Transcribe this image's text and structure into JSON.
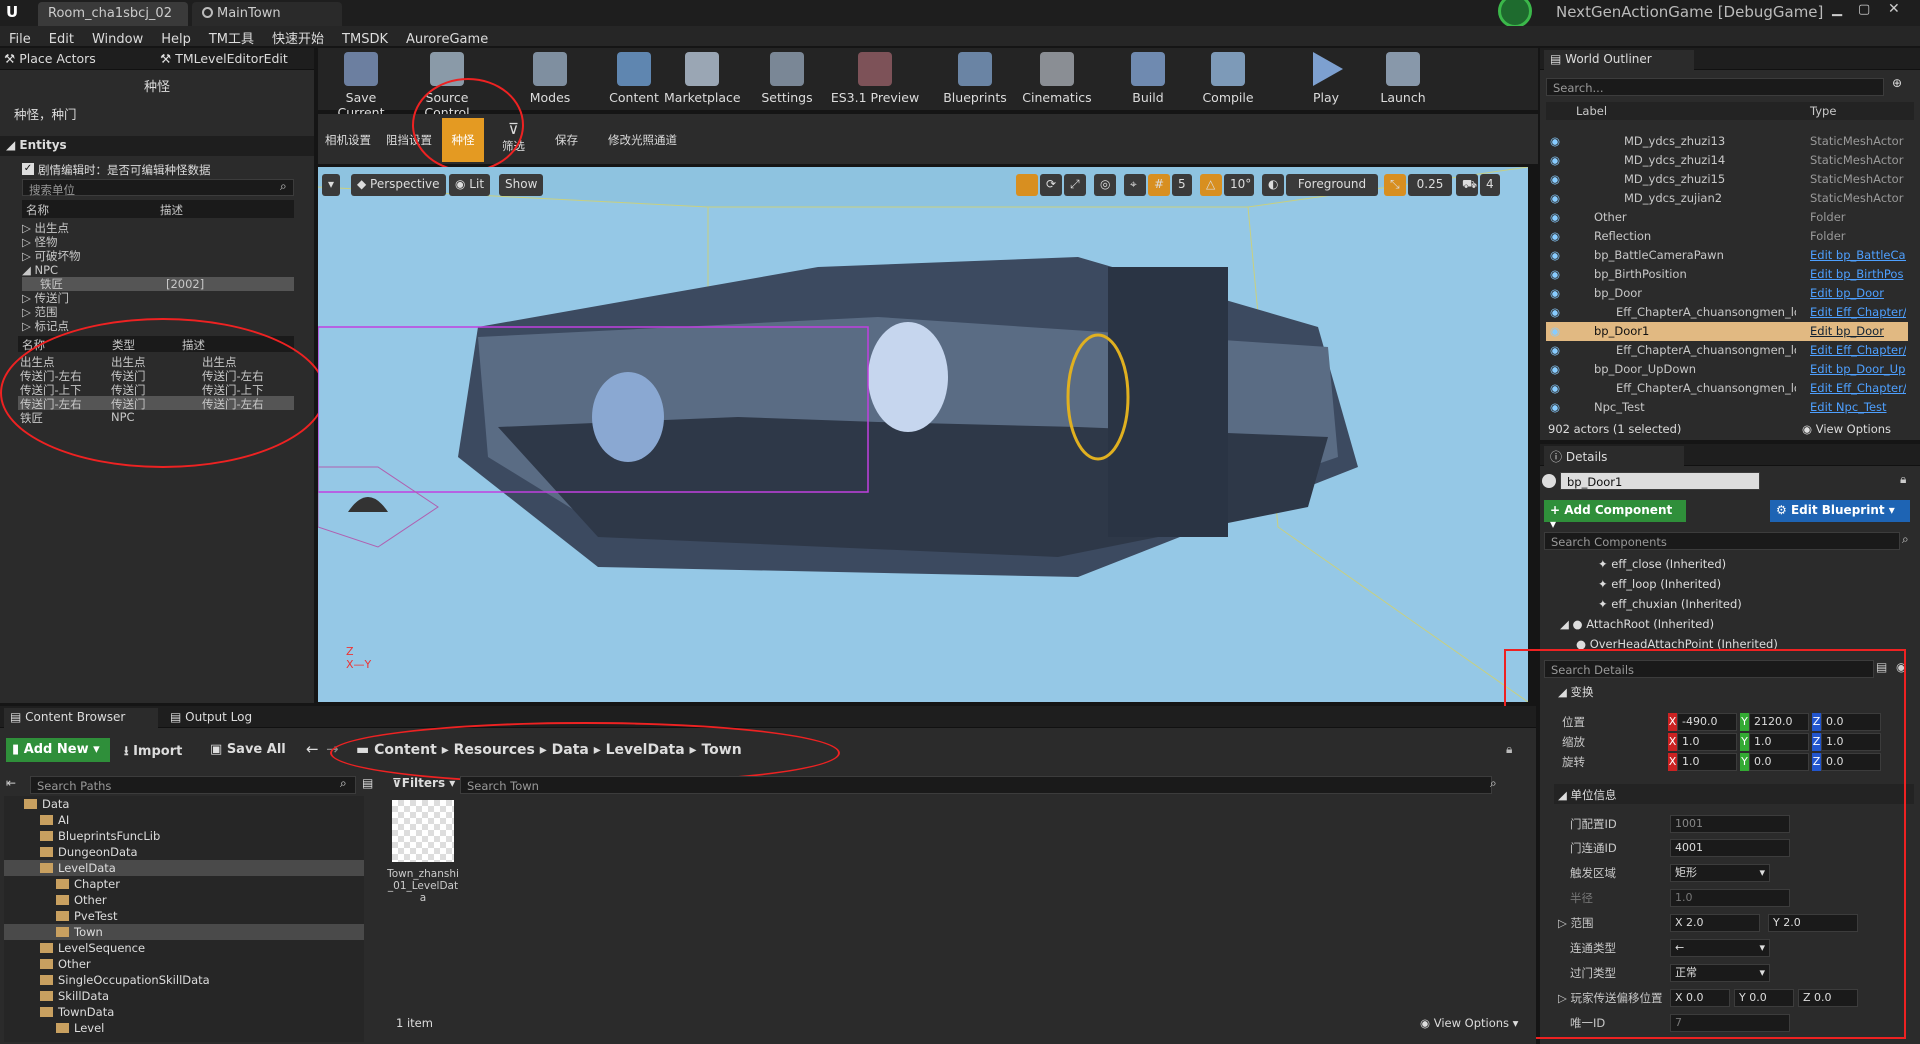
{
  "title_bar": {
    "tab1": "Room_cha1sbcj_02",
    "tab2": "MainTown",
    "project": "NextGenActionGame [DebugGame]"
  },
  "menu": [
    "File",
    "Edit",
    "Window",
    "Help",
    "TM工具",
    "快速开始",
    "TMSDK",
    "AurorеGame"
  ],
  "left": {
    "tab_place": "Place Actors",
    "tab_tm": "TMLevelEditorEdit",
    "panel_title": "种怪",
    "subtitle": "种怪，种门",
    "entitys": "Entitys",
    "checkbox_label": "剧情编辑时：是否可编辑种怪数据",
    "search_placeholder": "搜索单位",
    "col_name": "名称",
    "col_desc": "描述",
    "tree": [
      "出生点",
      "怪物",
      "可破坏物",
      "NPC",
      "传送门",
      "范围",
      "标记点"
    ],
    "npc_row": {
      "name": "铁匠",
      "desc": "[2002]"
    },
    "table_cols": [
      "名称",
      "类型",
      "描述"
    ],
    "table": [
      [
        "出生点",
        "出生点",
        "出生点"
      ],
      [
        "传送门-左右",
        "传送门",
        "传送门-左右"
      ],
      [
        "传送门-上下",
        "传送门",
        "传送门-上下"
      ],
      [
        "传送门-左右",
        "传送门",
        "传送门-左右"
      ],
      [
        "铁匠",
        "NPC",
        ""
      ]
    ]
  },
  "toolbar": [
    "Save Current",
    "Source Control",
    "Modes",
    "Content",
    "Marketplace",
    "Settings",
    "ES3.1 Preview",
    "Blueprints",
    "Cinematics",
    "Build",
    "Compile",
    "Play",
    "Launch"
  ],
  "subtoolbar": [
    "相机设置",
    "阻挡设置",
    "种怪",
    "筛选",
    "保存",
    "修改光照通道"
  ],
  "viewport": {
    "perspective": "Perspective",
    "lit": "Lit",
    "show": "Show",
    "grid": "5",
    "angle": "10°",
    "foreground": "Foreground",
    "scale": "0.25",
    "speed": "4"
  },
  "outliner": {
    "title": "World Outliner",
    "search": "Search...",
    "col_label": "Label",
    "col_type": "Type",
    "rows": [
      {
        "label": "MD_ydcs_zhuzi13",
        "type": "StaticMeshActor"
      },
      {
        "label": "MD_ydcs_zhuzi14",
        "type": "StaticMeshActor"
      },
      {
        "label": "MD_ydcs_zhuzi15",
        "type": "StaticMeshActor"
      },
      {
        "label": "MD_ydcs_zujian2",
        "type": "StaticMeshActor"
      },
      {
        "label": "Other",
        "type": "Folder"
      },
      {
        "label": "Reflection",
        "type": "Folder"
      },
      {
        "label": "bp_BattleCameraPawn",
        "type": "Edit bp_BattleCai"
      },
      {
        "label": "bp_BirthPosition",
        "type": "Edit bp_BirthPos"
      },
      {
        "label": "bp_Door",
        "type": "Edit bp_Door"
      },
      {
        "label": "Eff_ChapterA_chuansongmen_lo",
        "type": "Edit Eff_Chapter/"
      },
      {
        "label": "bp_Door1",
        "type": "Edit bp_Door"
      },
      {
        "label": "Eff_ChapterA_chuansongmen_lo",
        "type": "Edit Eff_Chapter/"
      },
      {
        "label": "bp_Door_UpDown",
        "type": "Edit bp_Door_Up"
      },
      {
        "label": "Eff_ChapterA_chuansongmen_lo",
        "type": "Edit Eff_Chapter/"
      },
      {
        "label": "Npc_Test",
        "type": "Edit Npc_Test"
      }
    ],
    "count": "902 actors (1 selected)",
    "view_options": "View Options"
  },
  "details": {
    "title": "Details",
    "name": "bp_Door1",
    "add_component": "+ Add Component",
    "edit_bp": "Edit Blueprint",
    "search_comp": "Search Components",
    "components": [
      "eff_close (Inherited)",
      "eff_loop (Inherited)",
      "eff_chuxian (Inherited)",
      "AttachRoot (Inherited)",
      "OverHeadAttachPoint (Inherited)"
    ],
    "search_details": "Search Details",
    "transform": "变换",
    "pos_label": "位置",
    "scale_label": "缩放",
    "rot_label": "旋转",
    "pos": [
      "-490.0",
      "2120.0",
      "0.0"
    ],
    "scale": [
      "1.0",
      "1.0",
      "1.0"
    ],
    "rot": [
      "1.0",
      "0.0",
      "0.0"
    ],
    "unit_info": "单位信息",
    "door_cfg": "门配置ID",
    "door_cfg_v": "1001",
    "door_conn": "门连通ID",
    "door_conn_v": "4001",
    "trigger": "触发区域",
    "trigger_v": "矩形",
    "radius": "半径",
    "radius_v": "1.0",
    "range": "范围",
    "range_x": "2.0",
    "range_y": "2.0",
    "conn_type": "连通类型",
    "conn_type_v": "←",
    "pass_type": "过门类型",
    "pass_type_v": "正常",
    "offset": "玩家传送偏移位置",
    "off_x": "0.0",
    "off_y": "0.0",
    "off_z": "0.0",
    "uid": "唯一ID",
    "uid_v": "7"
  },
  "content": {
    "tab_cb": "Content Browser",
    "tab_log": "Output Log",
    "add_new": "Add New",
    "import": "Import",
    "save_all": "Save All",
    "path": [
      "Content",
      "Resources",
      "Data",
      "LevelData",
      "Town"
    ],
    "search_paths": "Search Paths",
    "filters": "Filters",
    "search_town": "Search Town",
    "tree": [
      "Data",
      "AI",
      "BlueprintsFuncLib",
      "DungeonData",
      "LevelData",
      "Chapter",
      "Other",
      "PveTest",
      "Town",
      "LevelSequence",
      "Other",
      "SingleOccupationSkillData",
      "SkillData",
      "TownData",
      "Level"
    ],
    "asset": "Town_zhanshi_01_LevelData",
    "count": "1 item",
    "view_options": "View Options"
  }
}
